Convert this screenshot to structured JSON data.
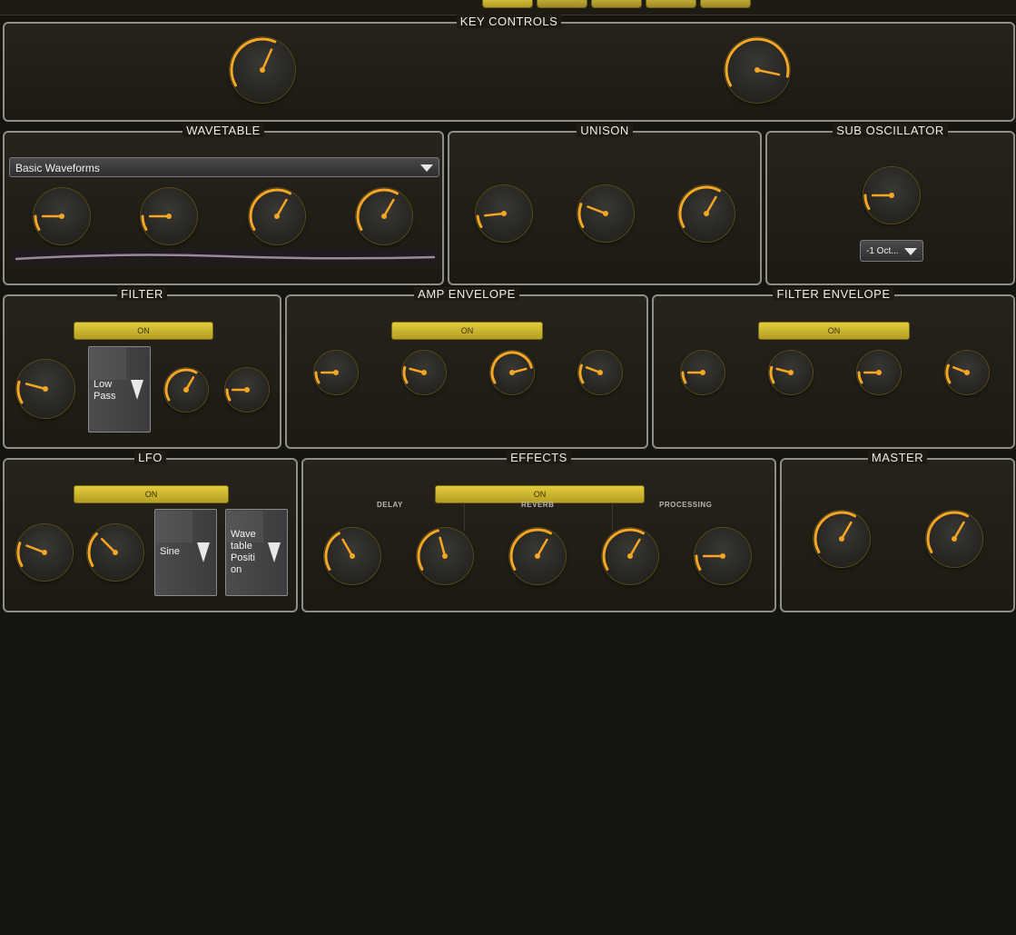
{
  "colors": {
    "accent": "#f5a623",
    "panel_border": "#8e8e88",
    "button": "#d4bd30"
  },
  "top_tabs": [
    {
      "active": true
    },
    {
      "active": false
    },
    {
      "active": false
    },
    {
      "active": false
    },
    {
      "active": false
    }
  ],
  "key_controls": {
    "title": "KEY CONTROLS",
    "knobs": [
      {
        "value": 0.48
      },
      {
        "value": 0.74
      }
    ]
  },
  "wavetable": {
    "title": "WAVETABLE",
    "selector_value": "Basic Waveforms",
    "knobs": [
      {
        "value": 0.1
      },
      {
        "value": 0.1
      },
      {
        "value": 0.5
      },
      {
        "value": 0.5
      }
    ]
  },
  "unison": {
    "title": "UNISON",
    "knobs": [
      {
        "value": 0.08
      },
      {
        "value": 0.17
      },
      {
        "value": 0.5
      }
    ]
  },
  "sub_oscillator": {
    "title": "SUB OSCILLATOR",
    "knobs": [
      {
        "value": 0.1
      }
    ],
    "octave_value": "-1 Oct..."
  },
  "filter": {
    "title": "FILTER",
    "on_label": "ON",
    "type_line1": "Low",
    "type_line2": "Pass",
    "knobs": [
      {
        "value": 0.15
      },
      {
        "value": 0.5
      },
      {
        "value": 0.1
      }
    ]
  },
  "amp_envelope": {
    "title": "AMP ENVELOPE",
    "on_label": "ON",
    "knobs": [
      {
        "value": 0.1
      },
      {
        "value": 0.15
      },
      {
        "value": 0.65
      },
      {
        "value": 0.17
      }
    ]
  },
  "filter_envelope": {
    "title": "FILTER ENVELOPE",
    "on_label": "ON",
    "knobs": [
      {
        "value": 0.1
      },
      {
        "value": 0.15
      },
      {
        "value": 0.1
      },
      {
        "value": 0.17
      }
    ]
  },
  "lfo": {
    "title": "LFO",
    "on_label": "ON",
    "shape": "Sine",
    "target_lines": [
      "Wave",
      "table",
      "Positi",
      "on"
    ],
    "knobs": [
      {
        "value": 0.17
      },
      {
        "value": 0.25
      }
    ]
  },
  "effects": {
    "title": "EFFECTS",
    "on_label": "ON",
    "sections": [
      "DELAY",
      "REVERB",
      "PROCESSING"
    ],
    "knobs": [
      {
        "value": 0.3
      },
      {
        "value": 0.35
      },
      {
        "value": 0.5
      },
      {
        "value": 0.5
      },
      {
        "value": 0.1
      }
    ]
  },
  "master": {
    "title": "MASTER",
    "knobs": [
      {
        "value": 0.5
      },
      {
        "value": 0.5
      }
    ]
  }
}
